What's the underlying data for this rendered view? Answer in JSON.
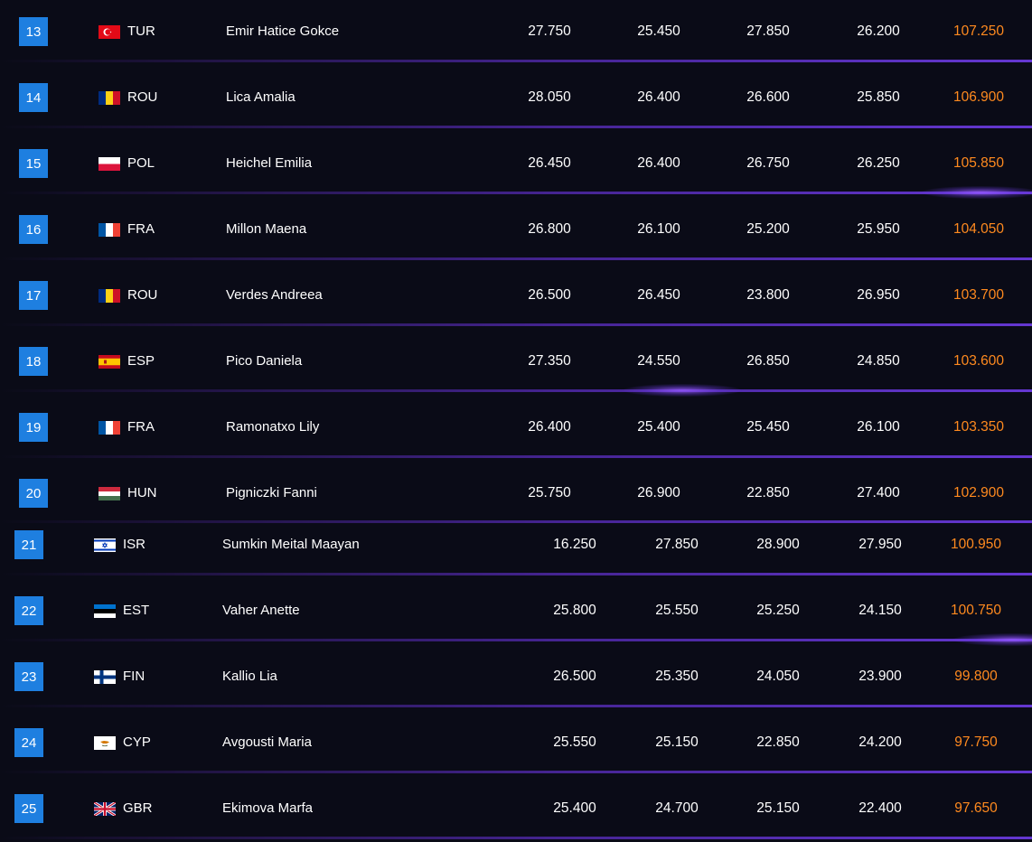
{
  "rows": [
    {
      "rank": "13",
      "nat": "TUR",
      "flag": "turkey-flag-icon",
      "name": "Emir Hatice Gokce",
      "scores": [
        "27.750",
        "25.450",
        "27.850",
        "26.200"
      ],
      "total": "107.250"
    },
    {
      "rank": "14",
      "nat": "ROU",
      "flag": "romania-flag-icon",
      "name": "Lica Amalia",
      "scores": [
        "28.050",
        "26.400",
        "26.600",
        "25.850"
      ],
      "total": "106.900"
    },
    {
      "rank": "15",
      "nat": "POL",
      "flag": "poland-flag-icon",
      "name": "Heichel Emilia",
      "scores": [
        "26.450",
        "26.400",
        "26.750",
        "26.250"
      ],
      "total": "105.850"
    },
    {
      "rank": "16",
      "nat": "FRA",
      "flag": "france-flag-icon",
      "name": "Millon Maena",
      "scores": [
        "26.800",
        "26.100",
        "25.200",
        "25.950"
      ],
      "total": "104.050"
    },
    {
      "rank": "17",
      "nat": "ROU",
      "flag": "romania-flag-icon",
      "name": "Verdes Andreea",
      "scores": [
        "26.500",
        "26.450",
        "23.800",
        "26.950"
      ],
      "total": "103.700"
    },
    {
      "rank": "18",
      "nat": "ESP",
      "flag": "spain-flag-icon",
      "name": "Pico Daniela",
      "scores": [
        "27.350",
        "24.550",
        "26.850",
        "24.850"
      ],
      "total": "103.600"
    },
    {
      "rank": "19",
      "nat": "FRA",
      "flag": "france-flag-icon",
      "name": "Ramonatxo Lily",
      "scores": [
        "26.400",
        "25.400",
        "25.450",
        "26.100"
      ],
      "total": "103.350"
    },
    {
      "rank": "20",
      "nat": "HUN",
      "flag": "hungary-flag-icon",
      "name": "Pigniczki Fanni",
      "scores": [
        "25.750",
        "26.900",
        "22.850",
        "27.400"
      ],
      "total": "102.900"
    },
    {
      "rank": "21",
      "nat": "ISR",
      "flag": "israel-flag-icon",
      "name": "Sumkin Meital Maayan",
      "scores": [
        "16.250",
        "27.850",
        "28.900",
        "27.950"
      ],
      "total": "100.950"
    },
    {
      "rank": "22",
      "nat": "EST",
      "flag": "estonia-flag-icon",
      "name": "Vaher Anette",
      "scores": [
        "25.800",
        "25.550",
        "25.250",
        "24.150"
      ],
      "total": "100.750"
    },
    {
      "rank": "23",
      "nat": "FIN",
      "flag": "finland-flag-icon",
      "name": "Kallio Lia",
      "scores": [
        "26.500",
        "25.350",
        "24.050",
        "23.900"
      ],
      "total": "99.800"
    },
    {
      "rank": "24",
      "nat": "CYP",
      "flag": "cyprus-flag-icon",
      "name": "Avgousti Maria",
      "scores": [
        "25.550",
        "25.150",
        "22.850",
        "24.200"
      ],
      "total": "97.750"
    },
    {
      "rank": "25",
      "nat": "GBR",
      "flag": "uk-flag-icon",
      "name": "Ekimova Marfa",
      "scores": [
        "25.400",
        "24.700",
        "25.150",
        "22.400"
      ],
      "total": "97.650"
    }
  ],
  "colors": {
    "background": "#0a0b17",
    "rank_badge": "#1e7fe0",
    "total": "#ff8a1f",
    "separator": "#6e3ce6"
  }
}
